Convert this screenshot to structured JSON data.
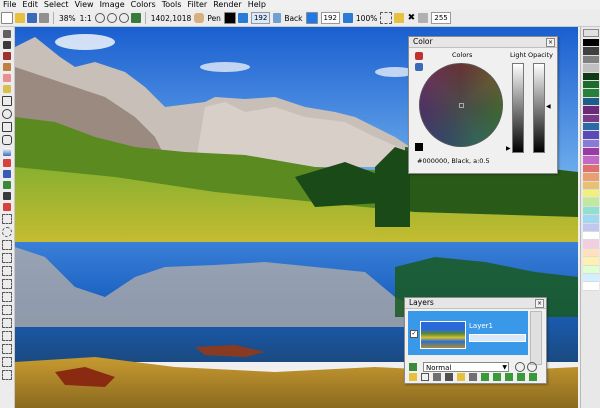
{
  "menu": [
    "File",
    "Edit",
    "Select",
    "View",
    "Image",
    "Colors",
    "Tools",
    "Filter",
    "Render",
    "Help"
  ],
  "toolbar": {
    "zoom": "38%",
    "ratio": "1:1",
    "size": "1402,1018",
    "tool": "Pen",
    "width": "192",
    "back_label": "Back",
    "opacity": "100%",
    "tolerance": "255"
  },
  "color_panel": {
    "title": "Color",
    "colors_label": "Colors",
    "light_label": "Light",
    "opacity_label": "Opacity",
    "readout": "#000000, Black, a:0.5"
  },
  "layers_panel": {
    "title": "Layers",
    "layer_name": "Layer1",
    "blend_mode": "Normal"
  },
  "palette_colors": [
    "#000000",
    "#404040",
    "#808080",
    "#c0c0c0",
    "#0f3a16",
    "#1d6b2a",
    "#26823a",
    "#1e5c8a",
    "#6b2a7a",
    "#7a3a8a",
    "#2a6aa8",
    "#5a4ab8",
    "#8a7ad8",
    "#9a3aa8",
    "#c06ac8",
    "#e07070",
    "#e8a070",
    "#e8c070",
    "#f0f080",
    "#c0e8a0",
    "#90e0d0",
    "#a0d8f0",
    "#c0c8f0",
    "#ffffff",
    "#f0d0e0",
    "#ffe0c0",
    "#fff0b0",
    "#e0ffd0",
    "#d0f0ff",
    "#ffffff"
  ]
}
